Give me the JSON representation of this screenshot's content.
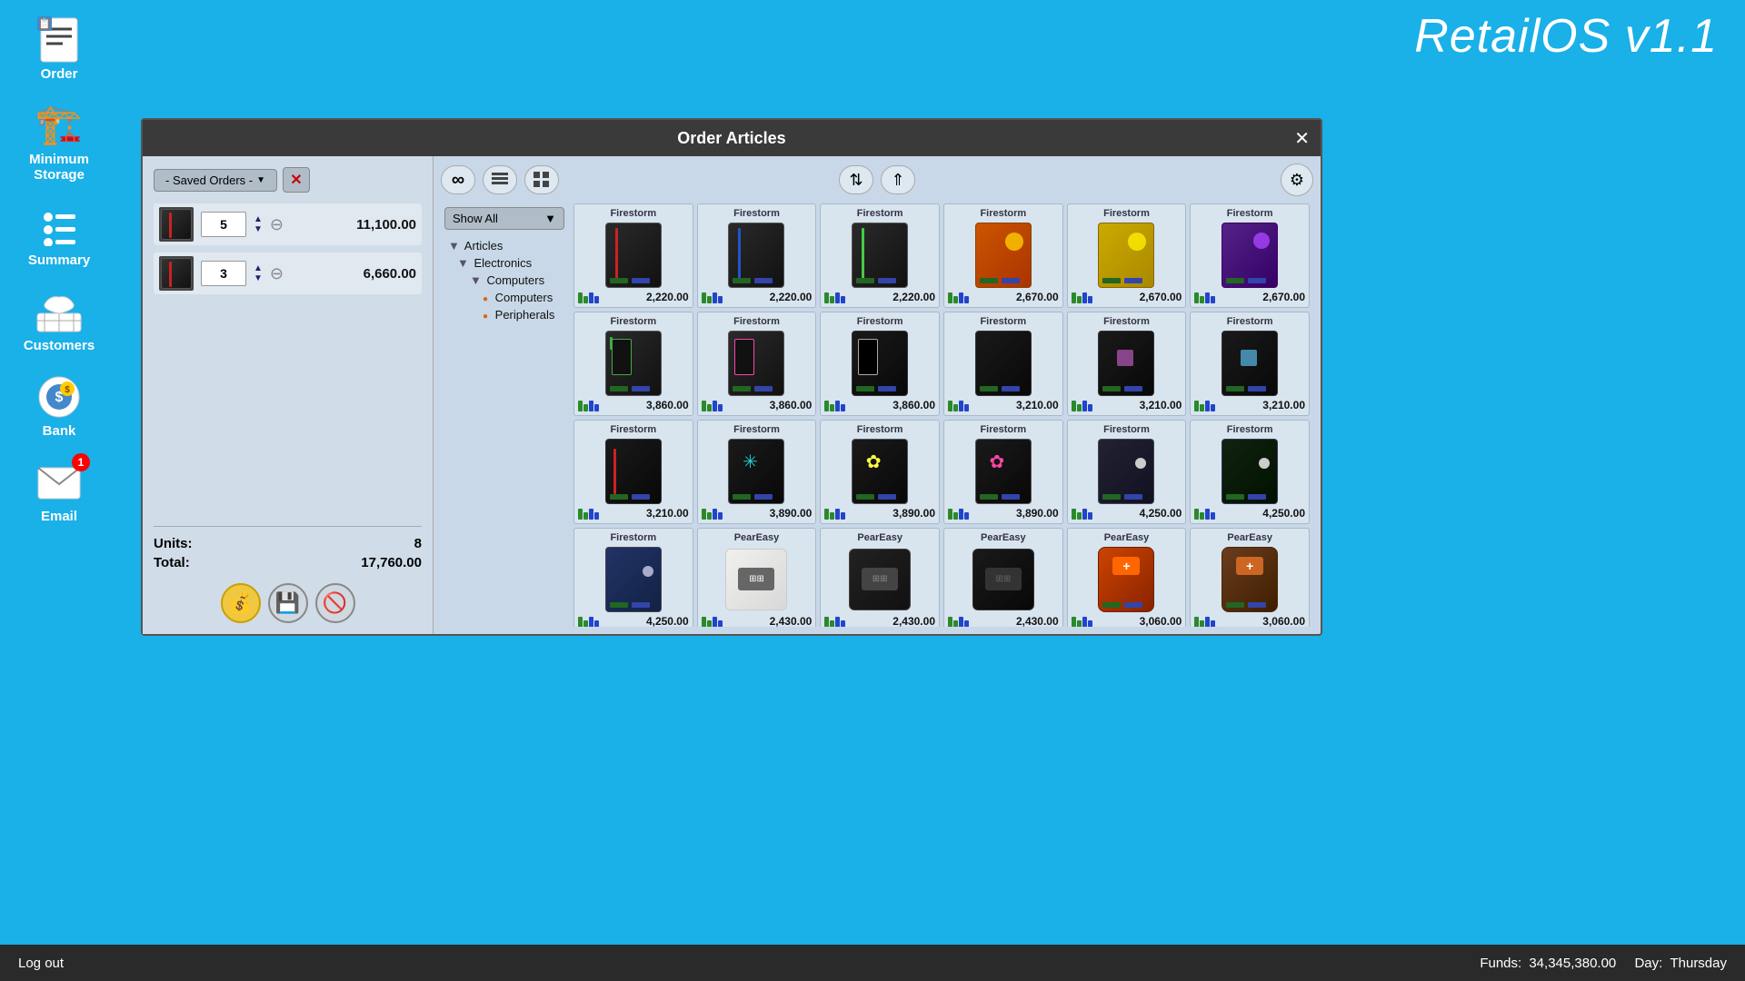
{
  "app": {
    "title": "RetailOS v1.1",
    "bottom_bar": {
      "logout": "Log out",
      "funds_label": "Funds:",
      "funds_value": "34,345,380.00",
      "day_label": "Day:",
      "day_value": "Thursday"
    }
  },
  "sidebar": {
    "items": [
      {
        "id": "order",
        "label": "Order",
        "icon": "📋"
      },
      {
        "id": "minimum-storage",
        "label": "Minimum\nStorage",
        "icon": "🏗️"
      },
      {
        "id": "summary",
        "label": "Summary",
        "icon": "📊"
      },
      {
        "id": "customers",
        "label": "Customers",
        "icon": "🛒"
      },
      {
        "id": "bank",
        "label": "Bank",
        "icon": "💰"
      },
      {
        "id": "email",
        "label": "Email",
        "icon": "✉️",
        "badge": 1
      }
    ]
  },
  "modal": {
    "title": "Order Articles",
    "close_label": "✕",
    "saved_orders_btn": "- Saved Orders -",
    "filter": {
      "selected": "Show All",
      "options": [
        "Show All",
        "Electronics",
        "Computers",
        "Peripherals"
      ]
    },
    "order_rows": [
      {
        "qty": 5,
        "price": "11,100.00"
      },
      {
        "qty": 3,
        "price": "6,660.00"
      }
    ],
    "totals": {
      "units_label": "Units:",
      "units_value": "8",
      "total_label": "Total:",
      "total_value": "17,760.00"
    },
    "action_buttons": [
      {
        "id": "confirm-btn",
        "icon": "💰",
        "type": "gold"
      },
      {
        "id": "save-btn",
        "icon": "💾",
        "type": "normal"
      },
      {
        "id": "cancel-btn",
        "icon": "🚫",
        "type": "normal"
      }
    ],
    "toolbar": {
      "buttons": [
        {
          "id": "infinity-btn",
          "icon": "∞"
        },
        {
          "id": "list-btn",
          "icon": "📄"
        },
        {
          "id": "grid-btn",
          "icon": "⊞"
        },
        {
          "id": "sort-btn",
          "icon": "⇅"
        },
        {
          "id": "expand-btn",
          "icon": "⇑"
        },
        {
          "id": "settings-btn",
          "icon": "⚙"
        }
      ]
    },
    "tree": {
      "items": [
        {
          "label": "Articles",
          "indent": 0,
          "type": "triangle",
          "expanded": true
        },
        {
          "label": "Electronics",
          "indent": 1,
          "type": "triangle",
          "expanded": true
        },
        {
          "label": "Computers",
          "indent": 2,
          "type": "triangle",
          "expanded": true
        },
        {
          "label": "Computers",
          "indent": 3,
          "type": "dot"
        },
        {
          "label": "Peripherals",
          "indent": 3,
          "type": "dot"
        }
      ]
    },
    "products": [
      {
        "name": "Firestorm",
        "price": "2,220.00",
        "color": "red",
        "row": 1
      },
      {
        "name": "Firestorm",
        "price": "2,220.00",
        "color": "blue",
        "row": 1
      },
      {
        "name": "Firestorm",
        "price": "2,220.00",
        "color": "green",
        "row": 1
      },
      {
        "name": "Firestorm",
        "price": "2,670.00",
        "color": "orange",
        "row": 1
      },
      {
        "name": "Firestorm",
        "price": "2,670.00",
        "color": "yellow",
        "row": 1
      },
      {
        "name": "Firestorm",
        "price": "2,670.00",
        "color": "purple",
        "row": 1
      },
      {
        "name": "Firestorm",
        "price": "3,860.00",
        "color": "lime",
        "row": 2
      },
      {
        "name": "Firestorm",
        "price": "3,860.00",
        "color": "pink",
        "row": 2
      },
      {
        "name": "Firestorm",
        "price": "3,860.00",
        "color": "dark",
        "row": 2
      },
      {
        "name": "Firestorm",
        "price": "3,210.00",
        "color": "dark",
        "row": 2
      },
      {
        "name": "Firestorm",
        "price": "3,210.00",
        "color": "dark2",
        "row": 2
      },
      {
        "name": "Firestorm",
        "price": "3,210.00",
        "color": "dark3",
        "row": 2
      },
      {
        "name": "Firestorm",
        "price": "3,210.00",
        "color": "dark",
        "row": 3
      },
      {
        "name": "Firestorm",
        "price": "3,890.00",
        "color": "cyan",
        "row": 3
      },
      {
        "name": "Firestorm",
        "price": "3,890.00",
        "color": "white",
        "row": 3
      },
      {
        "name": "Firestorm",
        "price": "3,890.00",
        "color": "pink2",
        "row": 3
      },
      {
        "name": "Firestorm",
        "price": "4,250.00",
        "color": "dark4",
        "row": 3
      },
      {
        "name": "Firestorm",
        "price": "4,250.00",
        "color": "green2",
        "row": 3
      },
      {
        "name": "Firestorm",
        "price": "4,250.00",
        "color": "blue2",
        "row": 4
      },
      {
        "name": "PearEasy",
        "price": "2,430.00",
        "color": "white-box",
        "row": 4
      },
      {
        "name": "PearEasy",
        "price": "2,430.00",
        "color": "black-box",
        "row": 4
      },
      {
        "name": "PearEasy",
        "price": "2,430.00",
        "color": "black-box2",
        "row": 4
      },
      {
        "name": "PearEasy",
        "price": "3,060.00",
        "color": "orange-bag",
        "row": 4
      },
      {
        "name": "PearEasy",
        "price": "3,060.00",
        "color": "brown-bag",
        "row": 4
      }
    ]
  }
}
